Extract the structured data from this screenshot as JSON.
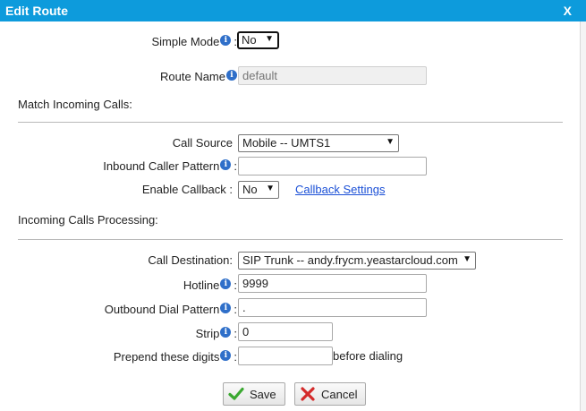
{
  "window": {
    "title": "Edit Route",
    "close": "X"
  },
  "simple_mode": {
    "label": "Simple Mode",
    "value": "No"
  },
  "route_name": {
    "label": "Route Name",
    "placeholder": "default",
    "value": ""
  },
  "match_section": {
    "title": "Match Incoming Calls:"
  },
  "call_source": {
    "label": "Call Source",
    "value": "Mobile -- UMTS1"
  },
  "inbound_caller_pattern": {
    "label": "Inbound Caller Pattern",
    "value": ""
  },
  "enable_callback": {
    "label": "Enable Callback :",
    "value": "No",
    "settings_link": "Callback Settings"
  },
  "processing_section": {
    "title": "Incoming Calls Processing:"
  },
  "call_destination": {
    "label": "Call Destination:",
    "value": "SIP Trunk -- andy.frycm.yeastarcloud.com"
  },
  "hotline": {
    "label": "Hotline",
    "value": "9999"
  },
  "outbound_dial_pattern": {
    "label": "Outbound Dial Pattern",
    "value": "."
  },
  "strip": {
    "label": "Strip",
    "value": "0"
  },
  "prepend": {
    "label": "Prepend these digits",
    "value": "",
    "suffix": "before dialing"
  },
  "buttons": {
    "save": "Save",
    "cancel": "Cancel"
  },
  "colors": {
    "title_bar": "#0d9bdc",
    "info_icon": "#2f6fc9",
    "link": "#1a4fd6",
    "save_check": "#3aa830",
    "cancel_x": "#d42a2a"
  },
  "icons": {
    "info": "info-icon",
    "save": "checkmark-icon",
    "cancel": "x-icon",
    "dropdown": "chevron-down-icon"
  }
}
